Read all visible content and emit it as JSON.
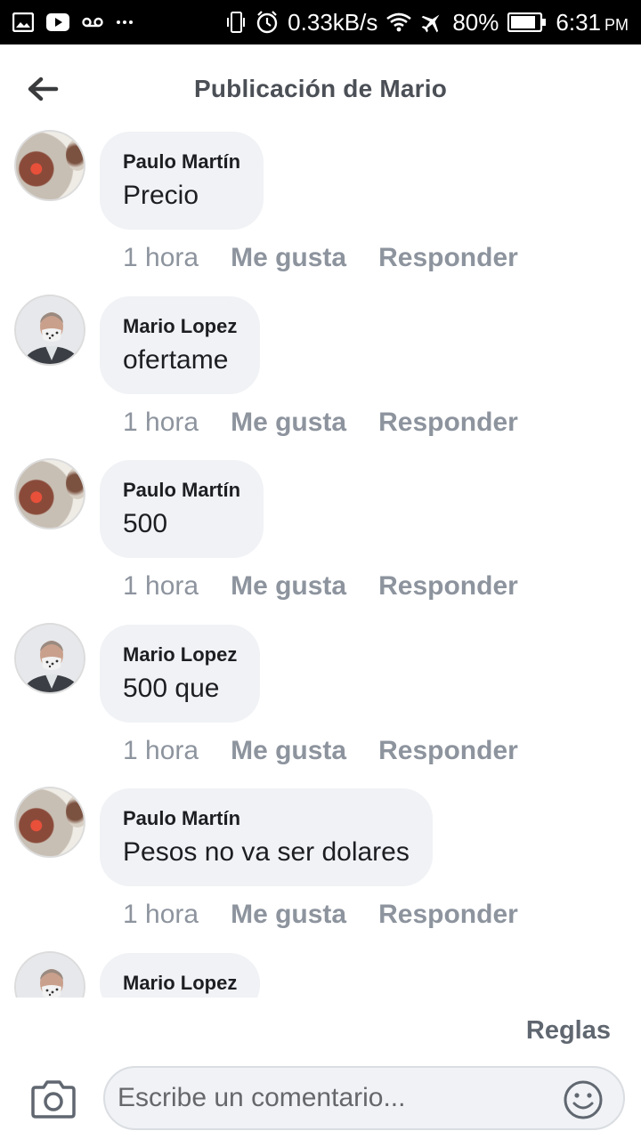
{
  "status_bar": {
    "network_speed": "0.33kB/s",
    "battery": "80%",
    "time": "6:31",
    "time_suffix": "PM",
    "icons": [
      "gallery-icon",
      "youtube-icon",
      "voicemail-icon",
      "more-icon",
      "vibrate-icon",
      "alarm-icon",
      "wifi-icon",
      "airplane-icon",
      "battery-icon"
    ]
  },
  "header": {
    "title": "Publicación de Mario",
    "back_icon": "arrow-left-icon"
  },
  "comments": [
    {
      "author": "Paulo Martín",
      "text": "Precio",
      "time": "1 hora",
      "like": "Me gusta",
      "reply": "Responder",
      "avatar": "paulo"
    },
    {
      "author": "Mario Lopez",
      "text": "ofertame",
      "time": "1 hora",
      "like": "Me gusta",
      "reply": "Responder",
      "avatar": "mario"
    },
    {
      "author": "Paulo Martín",
      "text": "500",
      "time": "1 hora",
      "like": "Me gusta",
      "reply": "Responder",
      "avatar": "paulo"
    },
    {
      "author": "Mario Lopez",
      "text": "500 que",
      "time": "1 hora",
      "like": "Me gusta",
      "reply": "Responder",
      "avatar": "mario"
    },
    {
      "author": "Paulo Martín",
      "text": "Pesos no va ser dolares",
      "time": "1 hora",
      "like": "Me gusta",
      "reply": "Responder",
      "avatar": "paulo"
    },
    {
      "author": "Mario Lopez",
      "text": "",
      "time": "",
      "like": "",
      "reply": "",
      "avatar": "mario"
    }
  ],
  "footer": {
    "rules_label": "Reglas",
    "input_placeholder": "Escribe un comentario...",
    "camera_icon": "camera-icon",
    "emoji_icon": "emoji-icon"
  },
  "colors": {
    "bubble": "#f0f2f5",
    "meta_text": "#8d949e",
    "title_text": "#4b4f56"
  }
}
